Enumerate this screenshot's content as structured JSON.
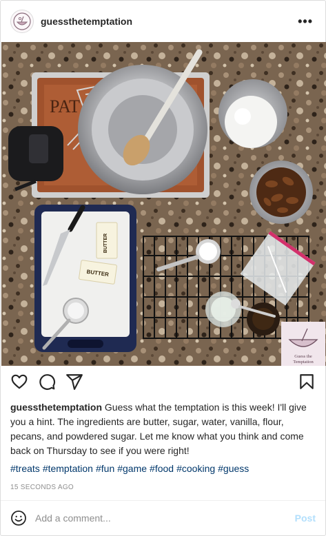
{
  "post": {
    "username": "guessthetemptation",
    "more_icon": "more-horizontal-icon",
    "caption_text": " Guess what the temptation is this week! I'll give you a hint. The ingredients are butter, sugar, water, vanilla, flour, pecans, and powdered sugar. Let me know what you think and come back on Thursday to see if you were right!",
    "hashtags": [
      "#treats",
      "#temptation",
      "#fun",
      "#game",
      "#food",
      "#cooking",
      "#guess"
    ],
    "timestamp": "15 SECONDS AGO"
  },
  "photo": {
    "butter_label": "BUTTER",
    "watermark_line1": "Guess the",
    "watermark_line2": "Temptation",
    "accent_brown": "#6a3a1e",
    "sheet_text": "PAT"
  },
  "actions": {
    "like_icon": "heart-icon",
    "comment_icon": "comment-icon",
    "share_icon": "send-icon",
    "save_icon": "bookmark-icon"
  },
  "comment": {
    "placeholder": "Add a comment...",
    "post_label": "Post"
  },
  "colors": {
    "link": "#00376b",
    "post_disabled": "#b2dffc",
    "muted": "#8e8e8e"
  }
}
